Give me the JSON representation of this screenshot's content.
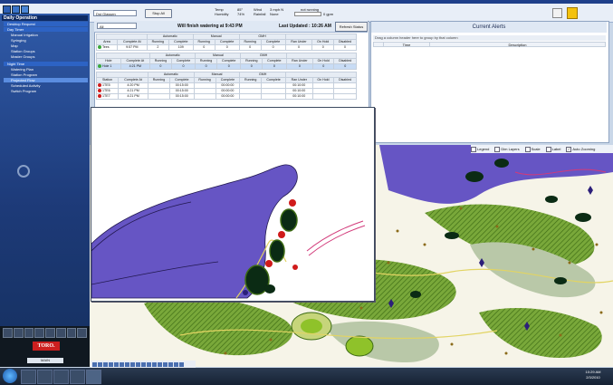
{
  "toolbar": {
    "controller_select": "Dst Glassen",
    "stop_all_label": "Stop All",
    "weather": {
      "temp_label": "Temp",
      "temp_value": "85°",
      "humidity_label": "Humidity",
      "humidity_value": "74%",
      "wind_label": "Wind",
      "wind_value": "3 mph N",
      "rainfall_label": "Rainfall",
      "rainfall_value": "None",
      "rain_status": "not running",
      "flow_value": "0 gpm"
    }
  },
  "sidebar": {
    "header": "Daily Operation",
    "items": [
      {
        "label": "Desktop Request",
        "type": "group"
      },
      {
        "label": "Day Timer",
        "type": "group"
      },
      {
        "label": "Manual Irrigation",
        "type": "item"
      },
      {
        "label": "Syringing",
        "type": "item"
      },
      {
        "label": "Map",
        "type": "item"
      },
      {
        "label": "Station Groups",
        "type": "item"
      },
      {
        "label": "Master Groups",
        "type": "item"
      },
      {
        "label": "Night Time",
        "type": "group"
      },
      {
        "label": "Watering Plan",
        "type": "item"
      },
      {
        "label": "Station Program",
        "type": "item"
      },
      {
        "label": "Projected Flow",
        "type": "item",
        "active": true
      },
      {
        "label": "Scheduled Activity",
        "type": "item"
      },
      {
        "label": "Switch Program",
        "type": "item"
      }
    ],
    "logo": "TORO.",
    "user": "MAIN"
  },
  "status": {
    "view_select": "All",
    "finish_text": "Will finish watering at 9:43 PM",
    "last_updated": "Last Updated : 10:26 AM",
    "refresh_label": "Refresh Status",
    "area_table": {
      "group_headers": [
        "Automatic",
        "Manual",
        "GMH"
      ],
      "columns": [
        "Area",
        "Complete At",
        "Running",
        "Complete",
        "Running",
        "Complete",
        "Running",
        "Complete",
        "Ran Under",
        "On Hold",
        "Disabled"
      ],
      "rows": [
        [
          "Tees",
          "9:57 PM",
          "2",
          "109",
          "0",
          "0",
          "0",
          "0",
          "0",
          "0",
          "0"
        ]
      ]
    },
    "hole_table": {
      "group_headers": [
        "Automatic",
        "Manual",
        "GMH"
      ],
      "columns": [
        "Hole",
        "Complete At",
        "Running",
        "Complete",
        "Running",
        "Complete",
        "Running",
        "Complete",
        "Ran Under",
        "On Hold",
        "Disabled"
      ],
      "rows": [
        [
          "Hole 1",
          "4:21 PM",
          "0",
          "0",
          "0",
          "0",
          "0",
          "0",
          "0",
          "0",
          "0"
        ]
      ]
    },
    "station_table": {
      "group_headers": [
        "Automatic",
        "Manual",
        "GMH"
      ],
      "columns": [
        "Station",
        "Complete At",
        "Running",
        "Complete",
        "Running",
        "Complete",
        "Running",
        "Complete",
        "Ran Under",
        "On Hold",
        "Disabled"
      ],
      "rows": [
        [
          "1TE5",
          "4:20 PM",
          "",
          "00:15:00",
          "",
          "00:00:00",
          "",
          "",
          "00:10:00",
          "",
          ""
        ],
        [
          "1TE6",
          "4:21 PM",
          "",
          "00:15:00",
          "",
          "00:00:00",
          "",
          "",
          "00:10:00",
          "",
          ""
        ],
        [
          "1TE7",
          "4:21 PM",
          "",
          "00:15:00",
          "",
          "00:00:00",
          "",
          "",
          "00:10:00",
          "",
          ""
        ]
      ]
    }
  },
  "alerts": {
    "title": "Current Alerts",
    "hint": "Drag a column header here to group by that column",
    "columns": [
      "Time",
      "Description"
    ]
  },
  "map_options": [
    {
      "label": "Legend",
      "checked": false
    },
    {
      "label": "Dim Layers",
      "checked": false
    },
    {
      "label": "Scale",
      "checked": false
    },
    {
      "label": "Label",
      "checked": false
    },
    {
      "label": "Auto Zooming",
      "checked": true
    }
  ],
  "taskbar": {
    "time": "10:29 AM",
    "date": "2/3/2010"
  },
  "colors": {
    "fairway": "#6a9a2e",
    "water": "#6655c4",
    "running_station": "#d01b1b",
    "tree": "#0b2b14",
    "sidebar": "#1d3a78"
  }
}
